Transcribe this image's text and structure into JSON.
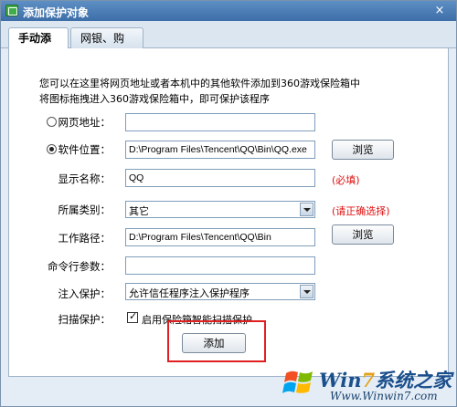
{
  "window": {
    "title": "添加保护对象",
    "close_glyph": "×"
  },
  "tabs": [
    {
      "label": "手动添加",
      "active": true
    },
    {
      "label": "网银、购物",
      "active": false
    }
  ],
  "intro": {
    "line1": "您可以在这里将网页地址或者本机中的其他软件添加到360游戏保险箱中",
    "line2": "将图标拖拽进入360游戏保险箱中，即可保护该程序"
  },
  "form": {
    "url": {
      "label": "网页地址：",
      "value": "",
      "selected": false
    },
    "software": {
      "label": "软件位置：",
      "value": "D:\\Program Files\\Tencent\\QQ\\Bin\\QQ.exe",
      "selected": true,
      "browse_label": "浏览"
    },
    "display_name": {
      "label": "显示名称：",
      "value": "QQ",
      "hint": "(必填)"
    },
    "category": {
      "label": "所属类别：",
      "value": "其它",
      "hint": "(请正确选择)"
    },
    "work_path": {
      "label": "工作路径：",
      "value": "D:\\Program Files\\Tencent\\QQ\\Bin",
      "browse_label": "浏览"
    },
    "cmd_params": {
      "label": "命令行参数：",
      "value": ""
    },
    "inject": {
      "label": "注入保护：",
      "value": "允许信任程序注入保护程序"
    },
    "scan": {
      "label": "扫描保护：",
      "checkbox_label": "启用保险箱智能扫描保护",
      "checked": true
    },
    "add_button": "添加"
  },
  "watermark": {
    "brand_prefix": "Win",
    "brand_seven": "7",
    "brand_suffix": "系统之家",
    "url": "Www.Winwin7.com"
  },
  "colors": {
    "title_bar": "#3d6ea8",
    "hint_red": "#e01010",
    "highlight_red": "#e02020"
  }
}
